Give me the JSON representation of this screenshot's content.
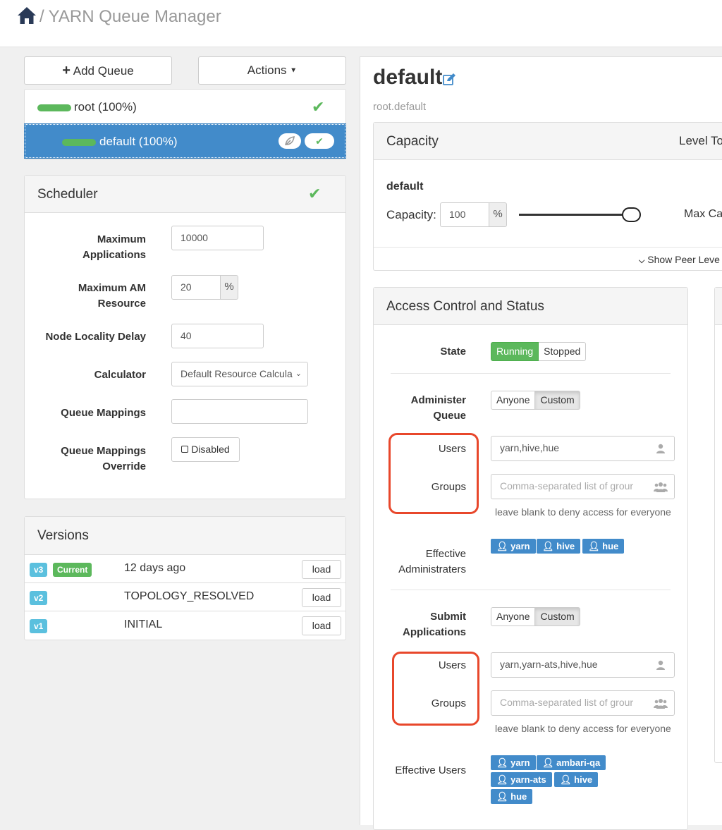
{
  "header": {
    "separator": "/",
    "title": "YARN Queue Manager"
  },
  "toolbar": {
    "add_queue": "Add Queue",
    "actions": "Actions"
  },
  "tree": [
    {
      "label": "root (100%)",
      "selected": false
    },
    {
      "label": "default (100%)",
      "selected": true
    }
  ],
  "scheduler": {
    "title": "Scheduler",
    "max_apps_label": "Maximum Applications",
    "max_apps_value": "10000",
    "max_am_label": "Maximum AM Resource",
    "max_am_value": "20",
    "max_am_unit": "%",
    "node_locality_label": "Node Locality Delay",
    "node_locality_value": "40",
    "calculator_label": "Calculator",
    "calculator_value": "Default Resource Calcula",
    "mappings_label": "Queue Mappings",
    "mappings_value": "",
    "override_label": "Queue Mappings Override",
    "override_value": "Disabled"
  },
  "versions": {
    "title": "Versions",
    "rows": [
      {
        "tag": "v3",
        "current": "Current",
        "name": "12 days ago",
        "action": "load"
      },
      {
        "tag": "v2",
        "current": "",
        "name": "TOPOLOGY_RESOLVED",
        "action": "load"
      },
      {
        "tag": "v1",
        "current": "",
        "name": "INITIAL",
        "action": "load"
      }
    ]
  },
  "queue": {
    "name": "default",
    "path": "root.default"
  },
  "capacity": {
    "title": "Capacity",
    "level_total": "Level To",
    "queue_name": "default",
    "capacity_label": "Capacity:",
    "capacity_value": "100",
    "unit": "%",
    "slider_fraction": 1.0,
    "max_label": "Max Ca",
    "show_peer": "Show Peer Leve"
  },
  "access": {
    "title": "Access Control and Status",
    "state_label": "State",
    "state_running": "Running",
    "state_stopped": "Stopped",
    "admin_label": "Administer Queue",
    "admin_anyone": "Anyone",
    "admin_custom": "Custom",
    "users_label": "Users",
    "groups_label": "Groups",
    "admin_users_value": "yarn,hive,hue",
    "groups_placeholder": "Comma-separated list of grour",
    "blank_hint": "leave blank to deny access for everyone",
    "effective_admin_label": "Effective Administraters",
    "effective_admins": [
      "yarn",
      "hive",
      "hue"
    ],
    "submit_label": "Submit Applications",
    "submit_anyone": "Anyone",
    "submit_custom": "Custom",
    "submit_users_value": "yarn,yarn-ats,hive,hue",
    "effective_users_label": "Effective Users",
    "effective_users": [
      "yarn",
      "ambari-qa",
      "yarn-ats",
      "hive",
      "hue"
    ]
  },
  "colors": {
    "primary": "#428bca",
    "success": "#5cb85c",
    "info": "#5bc0de",
    "highlight": "#e8472b"
  },
  "icons": [
    "home-icon",
    "plus-icon",
    "caret-down-icon",
    "check-icon",
    "leaf-icon",
    "edit-icon",
    "user-icon",
    "users-icon",
    "chevron-down-icon"
  ]
}
